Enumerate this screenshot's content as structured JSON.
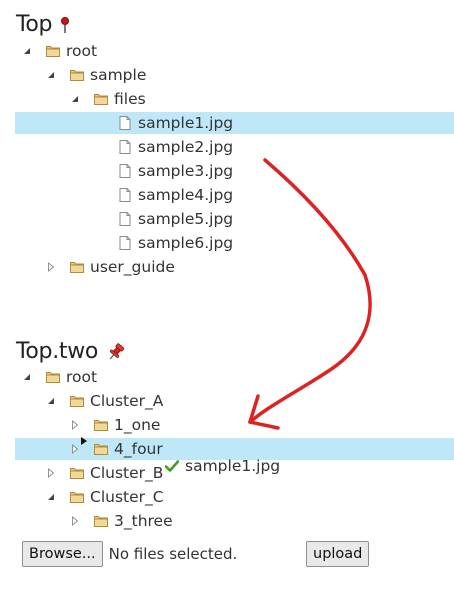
{
  "tree_top": {
    "title": "Top",
    "rows": [
      {
        "label": "root",
        "icon": "folder-icon",
        "arrow": "expanded"
      },
      {
        "label": "sample",
        "icon": "folder-icon",
        "arrow": "expanded"
      },
      {
        "label": "files",
        "icon": "folder-icon",
        "arrow": "expanded"
      },
      {
        "label": "sample1.jpg",
        "icon": "file-icon",
        "arrow": "none",
        "selected": true
      },
      {
        "label": "sample2.jpg",
        "icon": "file-icon",
        "arrow": "none"
      },
      {
        "label": "sample3.jpg",
        "icon": "file-icon",
        "arrow": "none"
      },
      {
        "label": "sample4.jpg",
        "icon": "file-icon",
        "arrow": "none"
      },
      {
        "label": "sample5.jpg",
        "icon": "file-icon",
        "arrow": "none"
      },
      {
        "label": "sample6.jpg",
        "icon": "file-icon",
        "arrow": "none"
      },
      {
        "label": "user_guide",
        "icon": "folder-icon",
        "arrow": "collapsed"
      }
    ]
  },
  "tree_two": {
    "title": "Top.two",
    "rows": [
      {
        "label": "root",
        "icon": "folder-icon",
        "arrow": "expanded"
      },
      {
        "label": "Cluster_A",
        "icon": "folder-icon",
        "arrow": "expanded"
      },
      {
        "label": "1_one",
        "icon": "folder-icon",
        "arrow": "collapsed"
      },
      {
        "label": "4_four",
        "icon": "folder-icon",
        "arrow": "collapsed",
        "selected": true
      },
      {
        "label": "Cluster_B",
        "icon": "folder-icon",
        "arrow": "collapsed"
      },
      {
        "label": "Cluster_C",
        "icon": "folder-icon",
        "arrow": "expanded"
      },
      {
        "label": "3_three",
        "icon": "folder-icon",
        "arrow": "collapsed"
      }
    ]
  },
  "drag": {
    "label": "sample1.jpg",
    "icon": "checkmark-icon"
  },
  "upload": {
    "browse_label": "Browse...",
    "status": "No files selected.",
    "upload_label": "upload"
  },
  "colors": {
    "selection": "#bee8f8",
    "arrow_annotation": "#dd2222",
    "check": "#3aa020",
    "folder": "#d9b46a"
  }
}
